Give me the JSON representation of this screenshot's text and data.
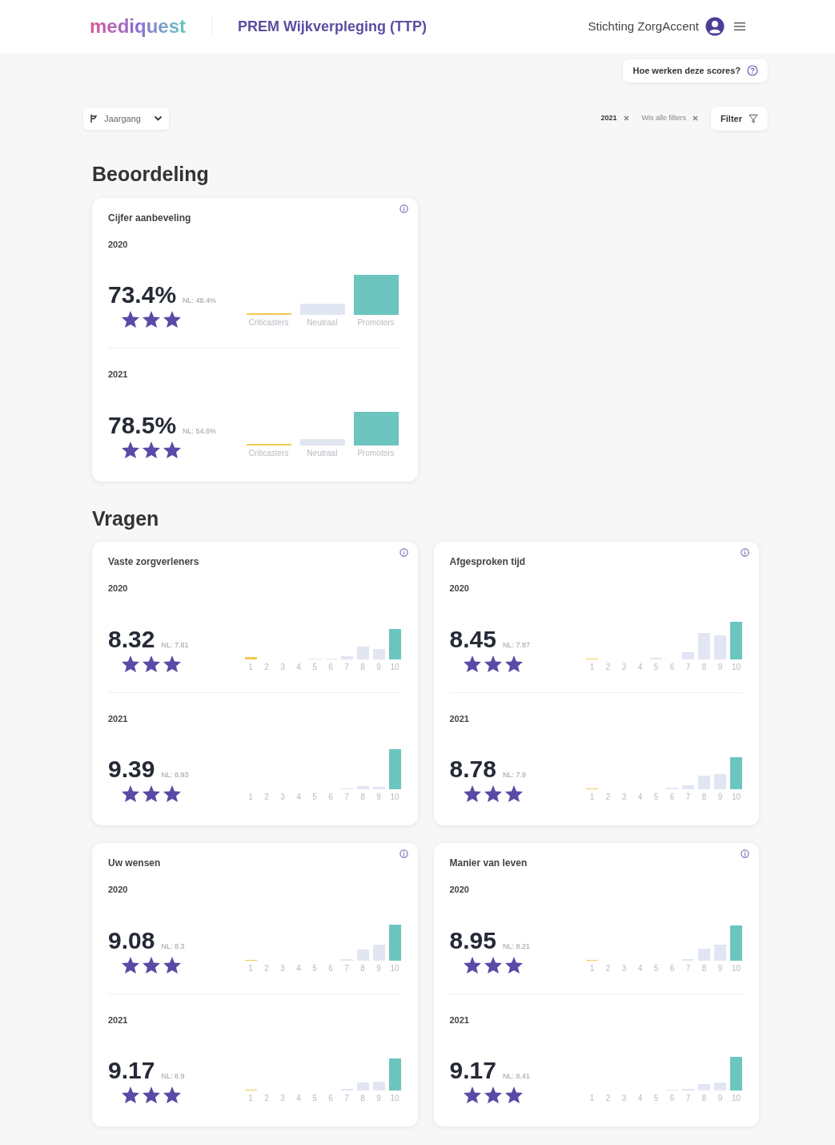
{
  "header": {
    "logo": "mediquest",
    "title": "PREM Wijkverpleging (TTP)",
    "organization": "Stichting ZorgAccent"
  },
  "help_button": {
    "label": "Hoe werken deze scores?"
  },
  "year_dropdown": {
    "label": "Jaargang"
  },
  "filter_chips": [
    {
      "label": "2021"
    },
    {
      "label": "Wis alle filters"
    }
  ],
  "filter_button": {
    "label": "Filter"
  },
  "sections": [
    {
      "title": "Beoordeling",
      "cards": [
        {
          "title": "Cijfer aanbeveling",
          "kind": "nps",
          "years": [
            {
              "year": "2020",
              "score": "73.4%",
              "benchmark": "NL: 48.4%",
              "stars": 3,
              "bar_labels": [
                "Criticasters",
                "Neutraal",
                "Promotors"
              ]
            },
            {
              "year": "2021",
              "score": "78.5%",
              "benchmark": "NL: 54.6%",
              "stars": 3,
              "bar_labels": [
                "Criticasters",
                "Neutraal",
                "Promotors"
              ]
            }
          ]
        }
      ]
    },
    {
      "title": "Vragen",
      "cards": [
        {
          "title": "Vaste zorgverleners",
          "kind": "scale",
          "years": [
            {
              "year": "2020",
              "score": "8.32",
              "benchmark": "NL: 7.81",
              "stars": 3,
              "bar_labels": [
                "1",
                "2",
                "3",
                "4",
                "5",
                "6",
                "7",
                "8",
                "9",
                "10"
              ]
            },
            {
              "year": "2021",
              "score": "9.39",
              "benchmark": "NL: 8.93",
              "stars": 3,
              "bar_labels": [
                "1",
                "2",
                "3",
                "4",
                "5",
                "6",
                "7",
                "8",
                "9",
                "10"
              ]
            }
          ]
        },
        {
          "title": "Afgesproken tijd",
          "kind": "scale",
          "years": [
            {
              "year": "2020",
              "score": "8.45",
              "benchmark": "NL: 7.87",
              "stars": 3,
              "bar_labels": [
                "1",
                "2",
                "3",
                "4",
                "5",
                "6",
                "7",
                "8",
                "9",
                "10"
              ]
            },
            {
              "year": "2021",
              "score": "8.78",
              "benchmark": "NL: 7.9",
              "stars": 3,
              "bar_labels": [
                "1",
                "2",
                "3",
                "4",
                "5",
                "6",
                "7",
                "8",
                "9",
                "10"
              ]
            }
          ]
        },
        {
          "title": "Uw wensen",
          "kind": "scale",
          "years": [
            {
              "year": "2020",
              "score": "9.08",
              "benchmark": "NL: 8.3",
              "stars": 3,
              "bar_labels": [
                "1",
                "2",
                "3",
                "4",
                "5",
                "6",
                "7",
                "8",
                "9",
                "10"
              ]
            },
            {
              "year": "2021",
              "score": "9.17",
              "benchmark": "NL: 8.9",
              "stars": 3,
              "bar_labels": [
                "1",
                "2",
                "3",
                "4",
                "5",
                "6",
                "7",
                "8",
                "9",
                "10"
              ]
            }
          ]
        },
        {
          "title": "Manier van leven",
          "kind": "scale",
          "years": [
            {
              "year": "2020",
              "score": "8.95",
              "benchmark": "NL: 8.21",
              "stars": 3,
              "bar_labels": [
                "1",
                "2",
                "3",
                "4",
                "5",
                "6",
                "7",
                "8",
                "9",
                "10"
              ]
            },
            {
              "year": "2021",
              "score": "9.17",
              "benchmark": "NL: 8.41",
              "stars": 3,
              "bar_labels": [
                "1",
                "2",
                "3",
                "4",
                "5",
                "6",
                "7",
                "8",
                "9",
                "10"
              ]
            }
          ]
        }
      ]
    }
  ]
}
